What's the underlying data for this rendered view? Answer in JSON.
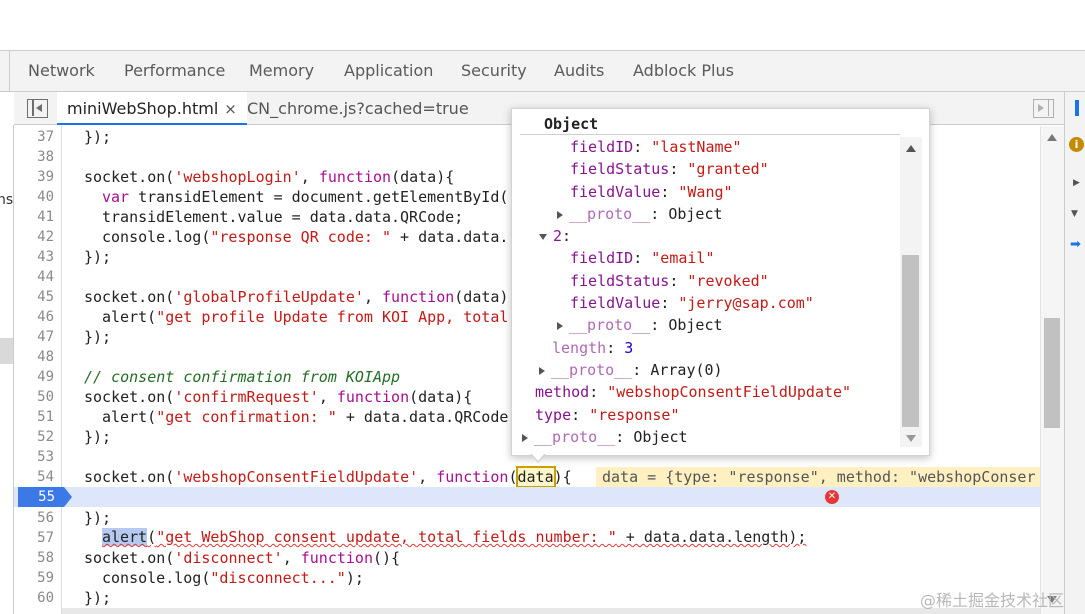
{
  "panel_tabs": [
    "Network",
    "Performance",
    "Memory",
    "Application",
    "Security",
    "Audits",
    "Adblock Plus"
  ],
  "file_tabs": {
    "active": "miniWebShop.html",
    "second": "CN_chrome.js?cached=true",
    "close_glyph": "×"
  },
  "sidebar_cut_text": "ns,",
  "editor": {
    "lines": [
      {
        "n": "37",
        "text": "});"
      },
      {
        "n": "38",
        "text": ""
      },
      {
        "n": "39",
        "text": "socket.on('webshopLogin', function(data){"
      },
      {
        "n": "40",
        "text": "var transidElement = document.getElementById("
      },
      {
        "n": "41",
        "text": "transidElement.value = data.data.QRCode;"
      },
      {
        "n": "42",
        "text": "console.log(\"response QR code: \" + data.data."
      },
      {
        "n": "43",
        "text": "});"
      },
      {
        "n": "44",
        "text": ""
      },
      {
        "n": "45",
        "text": "socket.on('globalProfileUpdate', function(data)"
      },
      {
        "n": "46",
        "text": "alert(\"get profile Update from KOI App, total"
      },
      {
        "n": "47",
        "text": "});"
      },
      {
        "n": "48",
        "text": ""
      },
      {
        "n": "49",
        "text": "// consent confirmation from KOIApp"
      },
      {
        "n": "50",
        "text": "socket.on('confirmRequest', function(data){"
      },
      {
        "n": "51",
        "text": "alert(\"get confirmation: \" + data.data.QRCode"
      },
      {
        "n": "52",
        "text": "});"
      },
      {
        "n": "53",
        "text": ""
      },
      {
        "n": "54",
        "text": "socket.on('webshopConsentFieldUpdate', function(data){"
      },
      {
        "n": "55",
        "text": "alert(\"get WebShop consent update, total fields number: \" + data.data.length);"
      },
      {
        "n": "56",
        "text": "});"
      },
      {
        "n": "57",
        "text": ""
      },
      {
        "n": "58",
        "text": "socket.on('disconnect', function(){"
      },
      {
        "n": "59",
        "text": "console.log(\"disconnect...\");"
      },
      {
        "n": "60",
        "text": "});"
      }
    ],
    "inline_value": "data = {type: \"response\", method: \"webshopConser",
    "breakpoint_line": "55"
  },
  "popover": {
    "title": "Object",
    "rows": [
      {
        "key": "fieldID",
        "value": "\"lastName\""
      },
      {
        "key": "fieldStatus",
        "value": "\"granted\""
      },
      {
        "key": "fieldValue",
        "value": "\"Wang\""
      },
      {
        "key": "__proto__",
        "value": "Object"
      },
      {
        "key": "2",
        "value": ""
      },
      {
        "key": "fieldID",
        "value": "\"email\""
      },
      {
        "key": "fieldStatus",
        "value": "\"revoked\""
      },
      {
        "key": "fieldValue",
        "value": "\"jerry@sap.com\""
      },
      {
        "key": "__proto__",
        "value": "Object"
      },
      {
        "key": "length",
        "value": "3"
      },
      {
        "key": "__proto__",
        "value": "Array(0)"
      },
      {
        "key": "method",
        "value": "\"webshopConsentFieldUpdate\""
      },
      {
        "key": "type",
        "value": "\"response\""
      },
      {
        "key": "__proto__",
        "value": "Object"
      }
    ]
  },
  "watermark": "@稀土掘金技术社区",
  "colors": {
    "accent": "#1a73e8",
    "breakpoint": "#3b79e6",
    "keyword": "#aa0d91",
    "string": "#c41a16",
    "comment": "#236e25",
    "object_key": "#881391",
    "error": "#e53935"
  },
  "icons": {
    "navigator_toggle": "navigator-toggle-icon",
    "debugger_toggle": "debugger-toggle-icon",
    "info": "info-icon",
    "error": "error-icon",
    "expand": "triangle-right-icon",
    "collapse": "triangle-down-icon"
  }
}
